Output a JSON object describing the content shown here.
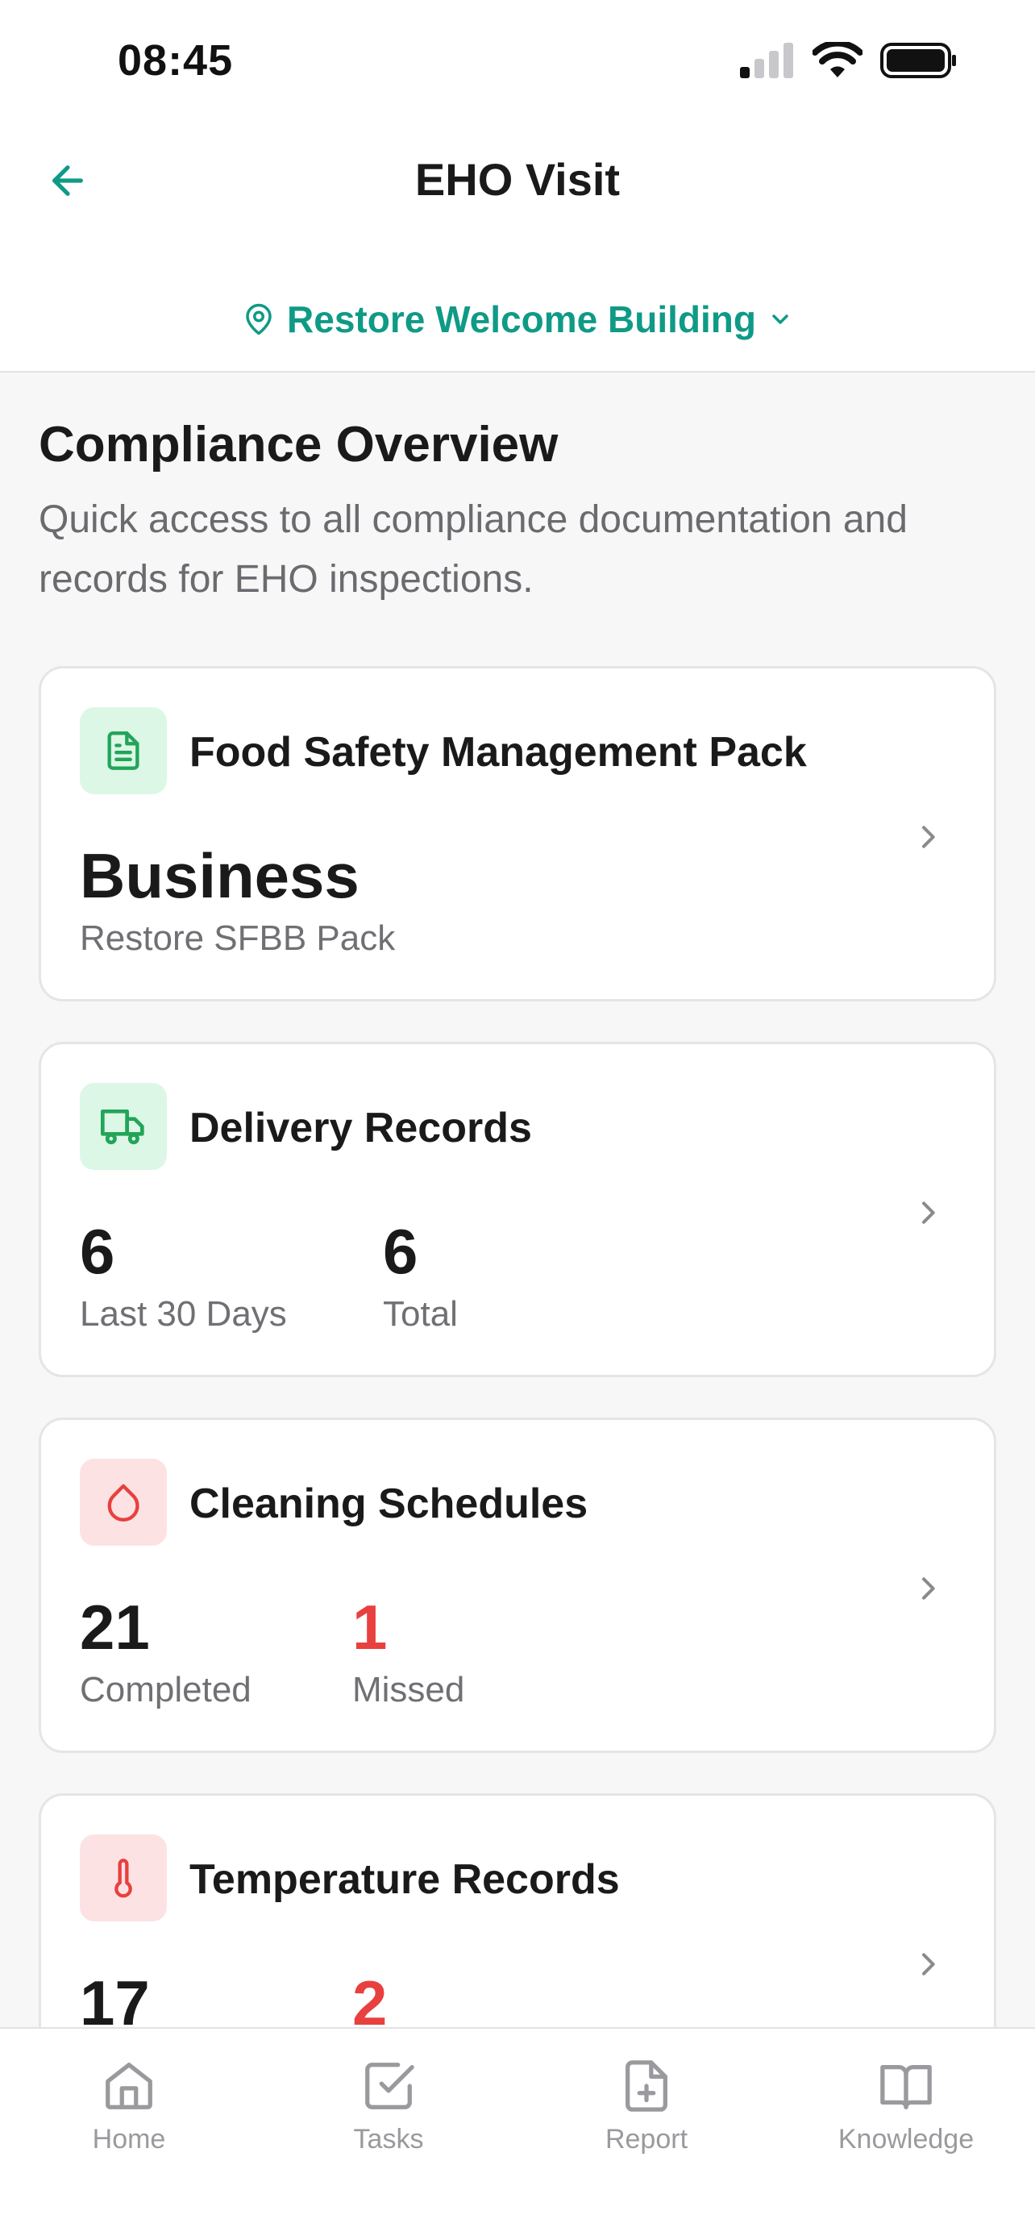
{
  "status_bar": {
    "time": "08:45"
  },
  "header": {
    "title": "EHO Visit",
    "back_icon": "arrow-left-icon",
    "location": "Restore Welcome Building",
    "accent_color": "#0f9a86"
  },
  "overview": {
    "title": "Compliance Overview",
    "subtitle": "Quick access to all compliance documentation and records for EHO inspections."
  },
  "cards": [
    {
      "title": "Food Safety Management Pack",
      "icon": "document-icon",
      "value": "Business",
      "caption": "Restore SFBB Pack"
    },
    {
      "title": "Delivery Records",
      "icon": "truck-icon",
      "stats": [
        {
          "value": "6",
          "label": "Last 30 Days"
        },
        {
          "value": "6",
          "label": "Total"
        }
      ]
    },
    {
      "title": "Cleaning Schedules",
      "icon": "droplet-icon",
      "stats": [
        {
          "value": "21",
          "label": "Completed"
        },
        {
          "value": "1",
          "label": "Missed",
          "alert_color": "#e8403f"
        }
      ]
    },
    {
      "title": "Temperature Records",
      "icon": "thermometer-icon",
      "stats": [
        {
          "value": "17",
          "label": ""
        },
        {
          "value": "2",
          "label": "",
          "alert_color": "#e8403f"
        }
      ]
    }
  ],
  "tabbar": {
    "items": [
      {
        "label": "Home",
        "icon": "home-icon"
      },
      {
        "label": "Tasks",
        "icon": "checkbox-icon"
      },
      {
        "label": "Report",
        "icon": "file-plus-icon"
      },
      {
        "label": "Knowledge",
        "icon": "book-icon"
      }
    ]
  }
}
